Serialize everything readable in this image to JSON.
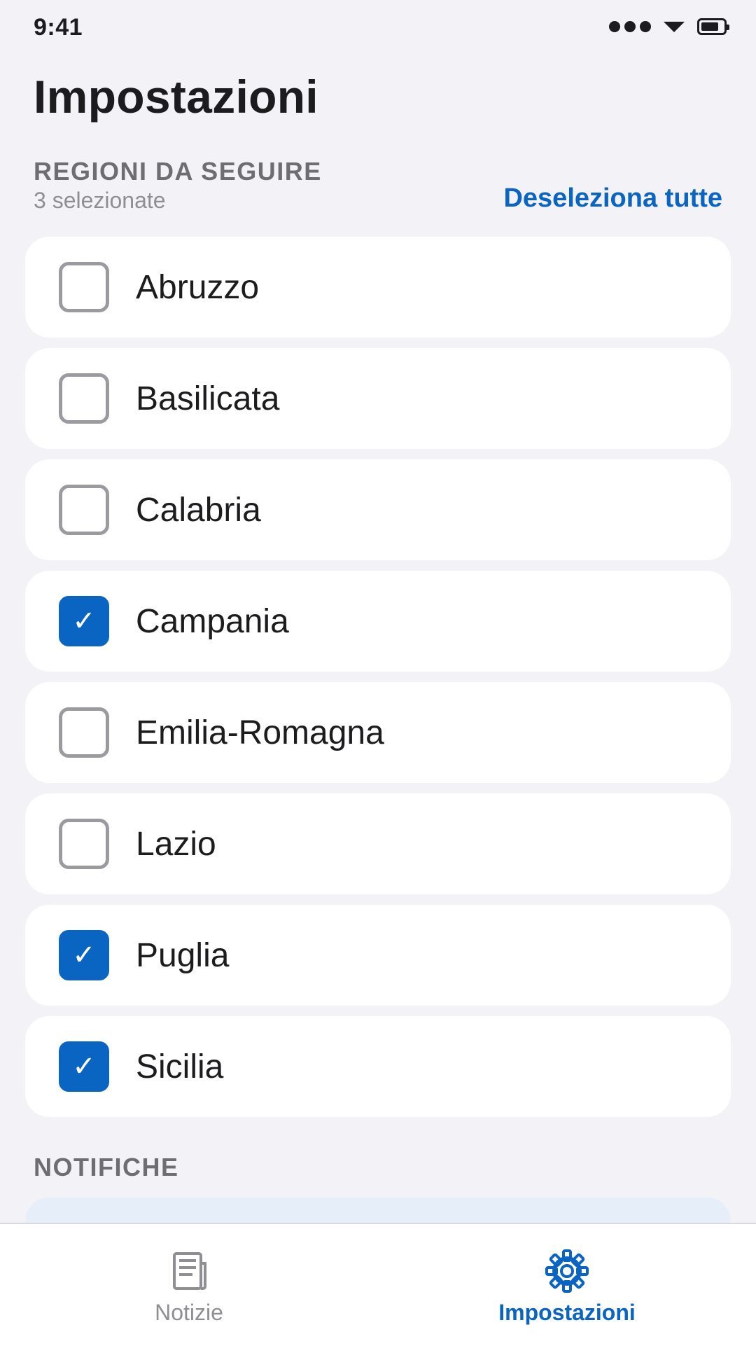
{
  "status_bar": {
    "time": "9:41",
    "icons": [
      "signal-dots-icon",
      "wifi-icon",
      "battery-icon"
    ]
  },
  "page": {
    "title": "Impostazioni"
  },
  "regions_section": {
    "header": "REGIONI DA SEGUIRE",
    "selected_count": "3 selezionate",
    "deselect_all_label": "Deseleziona tutte",
    "items": [
      {
        "label": "Abruzzo",
        "checked": false
      },
      {
        "label": "Basilicata",
        "checked": false
      },
      {
        "label": "Calabria",
        "checked": false
      },
      {
        "label": "Campania",
        "checked": true
      },
      {
        "label": "Emilia-Romagna",
        "checked": false
      },
      {
        "label": "Lazio",
        "checked": false
      },
      {
        "label": "Puglia",
        "checked": true
      },
      {
        "label": "Sicilia",
        "checked": true
      }
    ],
    "checkmark_glyph": "✓"
  },
  "notifications_section": {
    "header": "NOTIFICHE"
  },
  "tab_bar": {
    "tabs": [
      {
        "label": "Notizie",
        "icon": "newspaper-icon",
        "active": false
      },
      {
        "label": "Impostazioni",
        "icon": "gear-icon",
        "active": true
      }
    ]
  },
  "colors": {
    "accent": "#0a64c2",
    "background": "#f2f2f7",
    "card": "#ffffff",
    "secondary_text": "#6d6d72",
    "inactive_tab": "#8e8e93"
  }
}
